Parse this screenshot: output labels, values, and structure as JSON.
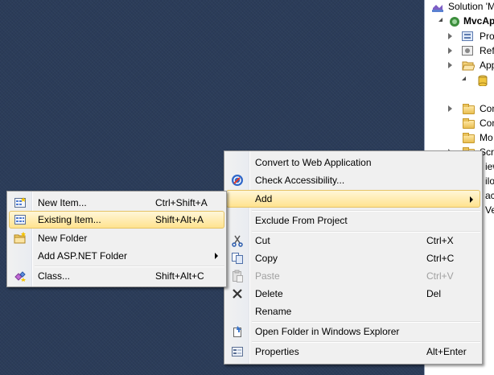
{
  "solution_explorer": {
    "items": [
      {
        "label": "Solution 'M",
        "icon": "solution-icon"
      },
      {
        "label": "MvcAp",
        "icon": "web-project-icon"
      },
      {
        "label": "Pro",
        "icon": "properties-icon"
      },
      {
        "label": "Refe",
        "icon": "references-icon"
      },
      {
        "label": "App",
        "icon": "folder-open-icon"
      },
      {
        "label": "",
        "icon": "database-icon"
      },
      {
        "label": "Con",
        "icon": "folder-icon"
      },
      {
        "label": "Con",
        "icon": "folder-icon"
      },
      {
        "label": "Mo",
        "icon": "folder-icon"
      },
      {
        "label": "Scri",
        "icon": "folder-icon"
      },
      {
        "label": "iew",
        "icon": ""
      },
      {
        "label": "ilob",
        "icon": ""
      },
      {
        "label": "ac",
        "icon": ""
      },
      {
        "label": "Veb",
        "icon": ""
      }
    ]
  },
  "context_menu": {
    "items": [
      {
        "label": "Convert to Web Application",
        "shortcut": ""
      },
      {
        "label": "Check Accessibility...",
        "shortcut": "",
        "icon": "accessibility-icon"
      },
      {
        "label": "Add",
        "shortcut": "",
        "submenu": true,
        "highlighted": true
      },
      {
        "label": "Exclude From Project",
        "shortcut": ""
      },
      {
        "label": "Cut",
        "shortcut": "Ctrl+X",
        "icon": "scissors-icon"
      },
      {
        "label": "Copy",
        "shortcut": "Ctrl+C",
        "icon": "copy-icon"
      },
      {
        "label": "Paste",
        "shortcut": "Ctrl+V",
        "icon": "paste-icon",
        "disabled": true
      },
      {
        "label": "Delete",
        "shortcut": "Del",
        "icon": "delete-icon"
      },
      {
        "label": "Rename",
        "shortcut": ""
      },
      {
        "label": "Open Folder in Windows Explorer",
        "shortcut": "",
        "icon": "open-folder-icon"
      },
      {
        "label": "Properties",
        "shortcut": "Alt+Enter",
        "icon": "properties-icon"
      }
    ]
  },
  "add_submenu": {
    "items": [
      {
        "label": "New Item...",
        "shortcut": "Ctrl+Shift+A",
        "icon": "new-item-icon"
      },
      {
        "label": "Existing Item...",
        "shortcut": "Shift+Alt+A",
        "icon": "existing-item-icon",
        "highlighted": true
      },
      {
        "label": "New Folder",
        "shortcut": "",
        "icon": "new-folder-icon"
      },
      {
        "label": "Add ASP.NET Folder",
        "shortcut": "",
        "submenu": true
      },
      {
        "label": "Class...",
        "shortcut": "Shift+Alt+C",
        "icon": "class-icon"
      }
    ]
  },
  "colors": {
    "desktop": "#2b3c59",
    "menu_bg": "#f0f0f0",
    "highlight_top": "#fff7d8",
    "highlight_bottom": "#ffe38f",
    "highlight_border": "#e5c365"
  }
}
